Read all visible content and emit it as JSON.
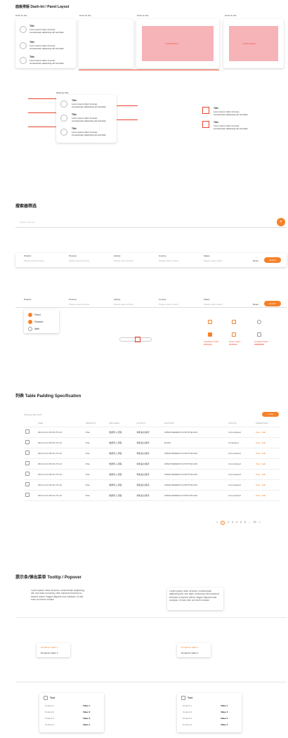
{
  "section1": {
    "title": "面板排版 Dash-let / Panel Layout",
    "headers": [
      "Dash-let title",
      "Dash-let title",
      "Dash-let title",
      "Dash-let title"
    ],
    "item_title": "Title",
    "item_text": "Lorem ipsum dolor sit amet, consectetuer adipiscing elit sed diam",
    "pink_label_a": "Content Area",
    "pink_label_b": "Content Area",
    "spec_header": "Dash-let Title"
  },
  "section2": {
    "title": "搜索器筛选",
    "search_placeholder": "Please enter key",
    "filters": [
      {
        "label": "Product",
        "placeholder": "Please select product"
      },
      {
        "label": "Process",
        "placeholder": "Please select process"
      },
      {
        "label": "Activity",
        "placeholder": "Please select activity"
      },
      {
        "label": "Country",
        "placeholder": "Please select country"
      },
      {
        "label": "Status",
        "placeholder": "Please select status"
      }
    ],
    "reset_label": "Reset",
    "search_label": "Search",
    "dropdown_options": [
      "Fixed",
      "Finance",
      "Web"
    ],
    "checkbox_captions": [
      "Checkbox Color: #F5822A",
      "Hover Color: #F5822A",
      "Unselect Color: #BBBBBB"
    ]
  },
  "section3": {
    "title": "列表 Table Padding Specification",
    "count_label": "Showing 100 result",
    "add_label": "+ New",
    "columns": [
      "",
      "TIME",
      "PRODUCT",
      "PROCESS",
      "ACTIVITY",
      "COUNTRY",
      "STATUS",
      "OPERATION"
    ],
    "rows": [
      {
        "time": "2022-12-13 08:40 UTC+8",
        "product": "Pole",
        "process": "数据导入流程",
        "activity": "审批提交事项",
        "country": "UNMANNERED/COUNTRY/ECHIN",
        "status": "Uncompleted"
      },
      {
        "time": "2022-12-13 08:40 UTC+8",
        "product": "Pole",
        "process": "数据导入流程",
        "activity": "审批提交事项",
        "country": "ECHIN",
        "status": "Completed"
      },
      {
        "time": "2022-12-13 08:40 UTC+8",
        "product": "Pole",
        "process": "数据导入流程",
        "activity": "审批提交事项",
        "country": "UNMANNERED/COUNTRY/ECHIN",
        "status": "Uncompleted"
      },
      {
        "time": "2022-12-13 08:40 UTC+8",
        "product": "Pole",
        "process": "数据导入流程",
        "activity": "审批提交事项",
        "country": "UNMANNERED/COUNTRY/ECHIN",
        "status": "Uncompleted"
      },
      {
        "time": "2022-12-13 08:40 UTC+8",
        "product": "Pole",
        "process": "数据导入流程",
        "activity": "审批提交事项",
        "country": "UNMANNERED/COUNTRY/ECHIN",
        "status": "Uncompleted"
      },
      {
        "time": "2022-12-13 08:40 UTC+8",
        "product": "Pole",
        "process": "数据导入流程",
        "activity": "审批提交事项",
        "country": "UNMANNERED/COUNTRY/ECHIN",
        "status": "Uncompleted"
      },
      {
        "time": "2022-12-13 08:40 UTC+8",
        "product": "Pole",
        "process": "数据导入流程",
        "activity": "审批提交事项",
        "country": "UNMANNERED/COUNTRY/ECHIN",
        "status": "Uncompleted"
      }
    ],
    "op_view": "View",
    "op_edit": "Edit",
    "pages": [
      "<",
      "1",
      "2",
      "3",
      "4",
      "5",
      "6",
      "...",
      "20",
      ">"
    ]
  },
  "section4": {
    "title": "提示条/弹出菜单 Tooltip / Popover",
    "tooltip_text": "Lorem ipsum dolor sit amet, consectetuer adipiscing elit, sed diam nonummy nibh euismod tincidunt ut laoreet dolore magna aliquam erat volutpat. Ut wisi enim ad minim veniam",
    "dropdown_values": [
      "Dropdown Value 1",
      "Dropdown Value 2"
    ],
    "pop_title": "Text",
    "pop_rows": [
      {
        "content": "Content 1",
        "value": "Value 1"
      },
      {
        "content": "Content 2",
        "value": "Value 2"
      },
      {
        "content": "Content 3",
        "value": "Value 3"
      },
      {
        "content": "Content 4",
        "value": "Value 4"
      }
    ]
  }
}
